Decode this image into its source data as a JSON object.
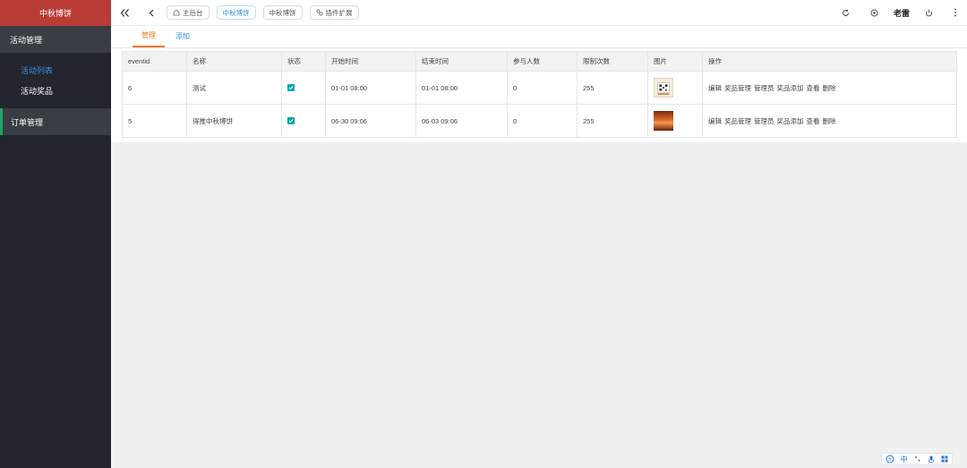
{
  "sidebar": {
    "brand": "中秋博饼",
    "groups": [
      {
        "label": "活动管理"
      },
      {
        "label": "订单管理"
      }
    ],
    "sub_items": [
      {
        "label": "活动列表",
        "active": true
      },
      {
        "label": "活动奖品",
        "active": false
      }
    ]
  },
  "topbar": {
    "tags": [
      {
        "label": "主后台",
        "icon": "home-icon"
      },
      {
        "label": "中秋博饼",
        "active": true
      },
      {
        "label": "中秋博饼"
      },
      {
        "label": "插件扩展",
        "icon": "plugin-icon"
      }
    ],
    "user": "老雷"
  },
  "tabs": [
    {
      "label": "管理",
      "active": true
    },
    {
      "label": "添加",
      "active": false
    }
  ],
  "table": {
    "headers": [
      "eventid",
      "名称",
      "状态",
      "开始时间",
      "结束时间",
      "参与人数",
      "限制次数",
      "图片",
      "操作"
    ],
    "rows": [
      {
        "eventid": "6",
        "name": "测试",
        "start": "01-01 08:00",
        "end": "01-01 08:00",
        "participants": "0",
        "limit": "255",
        "image": "qr"
      },
      {
        "eventid": "5",
        "name": "得推中秋博饼",
        "start": "06-30 09:06",
        "end": "06-03 09:06",
        "participants": "0",
        "limit": "255",
        "image": "photo"
      }
    ],
    "ops": [
      "编辑",
      "奖品管理",
      "管理员",
      "奖品添加",
      "查看",
      "删除"
    ]
  },
  "ime": {
    "lang": "中"
  },
  "colors": {
    "brand": "#b83b36",
    "accent_tab": "#e87c2a",
    "link": "#3c8ed8",
    "sidebar": "#23262e",
    "check": "#0aa8a8"
  }
}
